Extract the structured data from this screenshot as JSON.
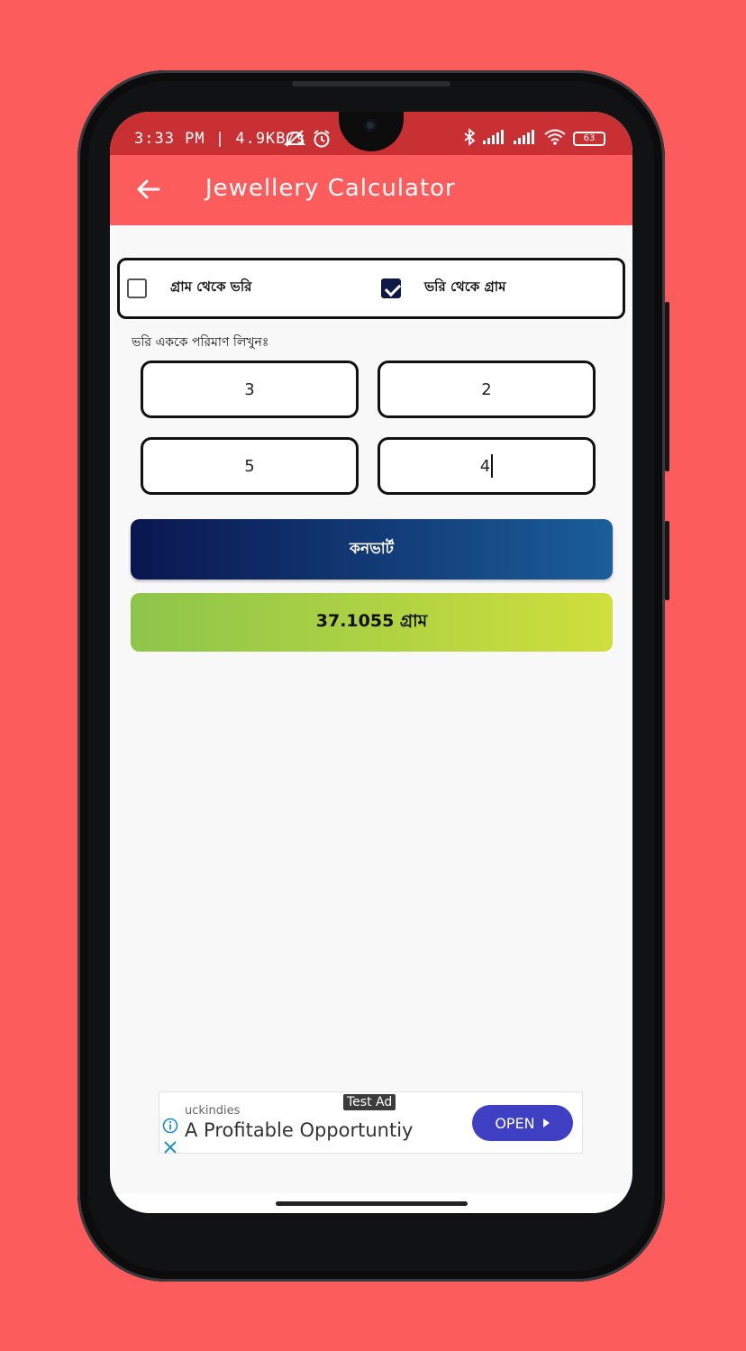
{
  "status_bar": {
    "left_text": "3:33 PM | 4.9KB/s",
    "battery": "63"
  },
  "app_bar": {
    "title": "Jewellery Calculator"
  },
  "mode_toggle": {
    "option_gram_to_vori": {
      "label": "গ্রাম থেকে ভরি",
      "checked": false
    },
    "option_vori_to_gram": {
      "label": "ভরি থেকে গ্রাম",
      "checked": true
    }
  },
  "input_prompt": "ভরি এককে পরিমাণ লিখুনঃ",
  "inputs": {
    "field_1": "3",
    "field_2": "2",
    "field_3": "5",
    "field_4": "4"
  },
  "convert_button": {
    "label": "কনভার্ট"
  },
  "result": {
    "text": "37.1055 গ্রাম"
  },
  "ad": {
    "tag": "Test Ad",
    "advertiser": "uckindies",
    "headline": "A Profitable Opportuntiy",
    "cta": "OPEN"
  },
  "colors": {
    "background": "#fd5c5c",
    "status_bar": "#c93034",
    "app_bar": "#fd5c5c",
    "convert_gradient_start": "#0a1650",
    "convert_gradient_end": "#1a5e9a",
    "result_gradient_start": "#8dc54a",
    "result_gradient_end": "#cfdf3c",
    "ad_button": "#3f3fc4"
  }
}
